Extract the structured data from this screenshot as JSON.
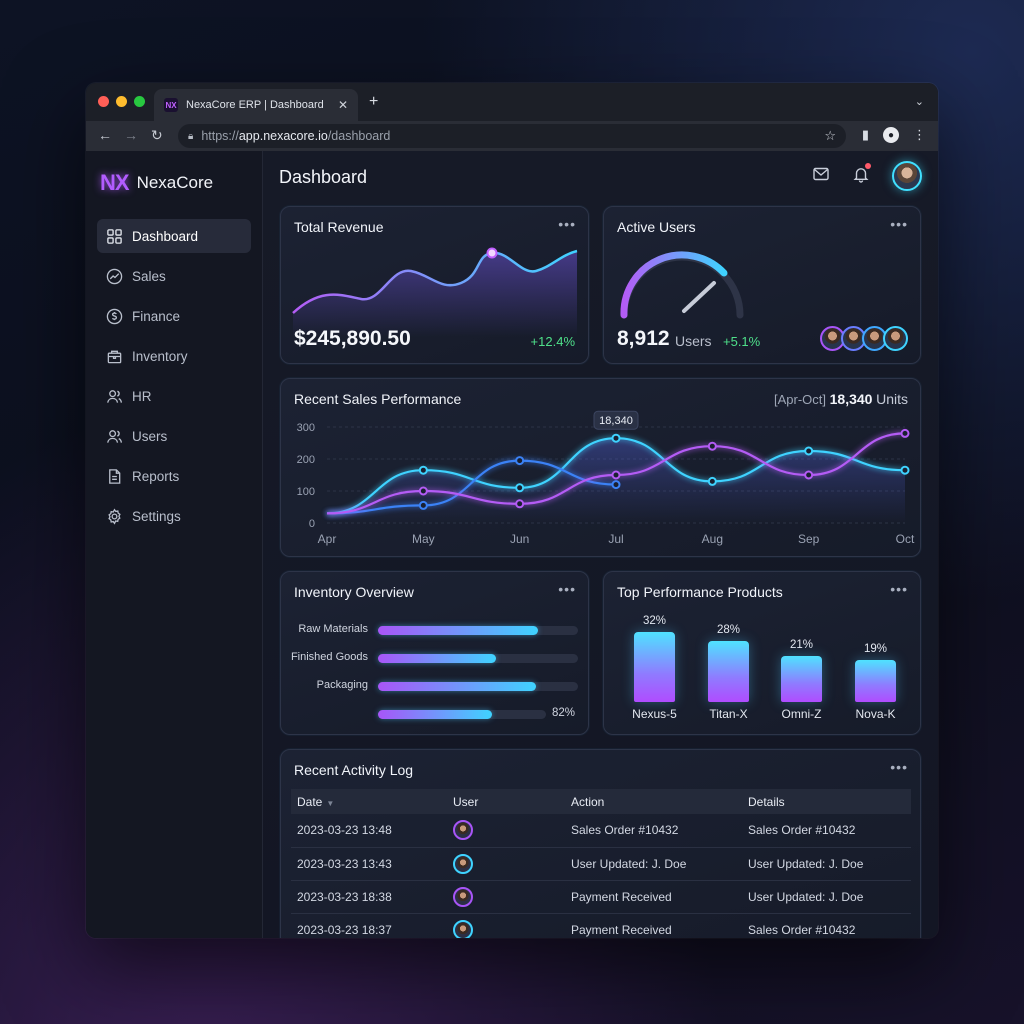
{
  "browser": {
    "tab_title": "NexaCore ERP | Dashboard",
    "favicon_text": "NX",
    "url_prefix": "https://",
    "url_host": "app.nexacore.io",
    "url_path": "/dashboard"
  },
  "brand": {
    "logo": "NX",
    "name": "NexaCore"
  },
  "sidebar": {
    "items": [
      {
        "label": "Dashboard",
        "icon": "grid-icon",
        "active": true
      },
      {
        "label": "Sales",
        "icon": "trend-icon"
      },
      {
        "label": "Finance",
        "icon": "dollar-icon"
      },
      {
        "label": "Inventory",
        "icon": "box-icon"
      },
      {
        "label": "HR",
        "icon": "user-icon"
      },
      {
        "label": "Users",
        "icon": "users-icon"
      },
      {
        "label": "Reports",
        "icon": "document-icon"
      },
      {
        "label": "Settings",
        "icon": "gear-icon"
      }
    ]
  },
  "header": {
    "title": "Dashboard"
  },
  "revenue": {
    "title": "Total Revenue",
    "value": "$245,890.50",
    "change": "+12.4%"
  },
  "active_users": {
    "title": "Active Users",
    "value": "8,912",
    "unit": "Users",
    "change": "+5.1%"
  },
  "sales_perf": {
    "title": "Recent Sales Performance",
    "range": "[Apr-Oct]",
    "total": "18,340",
    "units": "Units",
    "tooltip": "18,340"
  },
  "inventory": {
    "title": "Inventory Overview",
    "rows": [
      {
        "label": "Raw Materials",
        "level": 0.8
      },
      {
        "label": "Finished Goods",
        "level": 0.59
      },
      {
        "label": "Packaging",
        "level": 0.79
      },
      {
        "label": "",
        "level": 0.68,
        "pct": "82%"
      }
    ]
  },
  "products": {
    "title": "Top Performance Products",
    "items": [
      {
        "name": "Nexus-5",
        "pct": "32%",
        "value": 32
      },
      {
        "name": "Titan-X",
        "pct": "28%",
        "value": 28
      },
      {
        "name": "Omni-Z",
        "pct": "21%",
        "value": 21
      },
      {
        "name": "Nova-K",
        "pct": "19%",
        "value": 19
      }
    ]
  },
  "activity": {
    "title": "Recent Activity Log",
    "columns": [
      "Date",
      "User",
      "Action",
      "Details"
    ],
    "rows": [
      {
        "date": "2023-03-23 13:48",
        "action": "Sales Order #10432",
        "details": "Sales Order #10432"
      },
      {
        "date": "2023-03-23 13:43",
        "action": "User Updated: J. Doe",
        "details": "User Updated: J. Doe"
      },
      {
        "date": "2023-03-23 18:38",
        "action": "Payment Received",
        "details": "User Updated: J. Doe"
      },
      {
        "date": "2023-03-23 18:37",
        "action": "Payment Received",
        "details": "Sales Order #10432"
      }
    ]
  },
  "chart_data": {
    "type": "line",
    "title": "Recent Sales Performance",
    "categories": [
      "Apr",
      "May",
      "Jun",
      "Jul",
      "Aug",
      "Sep",
      "Oct"
    ],
    "ylim": [
      0,
      300
    ],
    "yticks": [
      0,
      100,
      200,
      300
    ],
    "grid": true,
    "series": [
      {
        "color": "#3fd3ff",
        "values": [
          30,
          165,
          110,
          265,
          130,
          225,
          165
        ]
      },
      {
        "color": "#3b82f6",
        "values": [
          30,
          55,
          195,
          120,
          null,
          null,
          null
        ]
      },
      {
        "color": "#b45cf5",
        "values": [
          30,
          100,
          60,
          150,
          240,
          150,
          280
        ]
      }
    ]
  },
  "colors": {
    "accent_cyan": "#3fd3ff",
    "accent_purple": "#a855f7",
    "positive": "#4ee08a"
  }
}
